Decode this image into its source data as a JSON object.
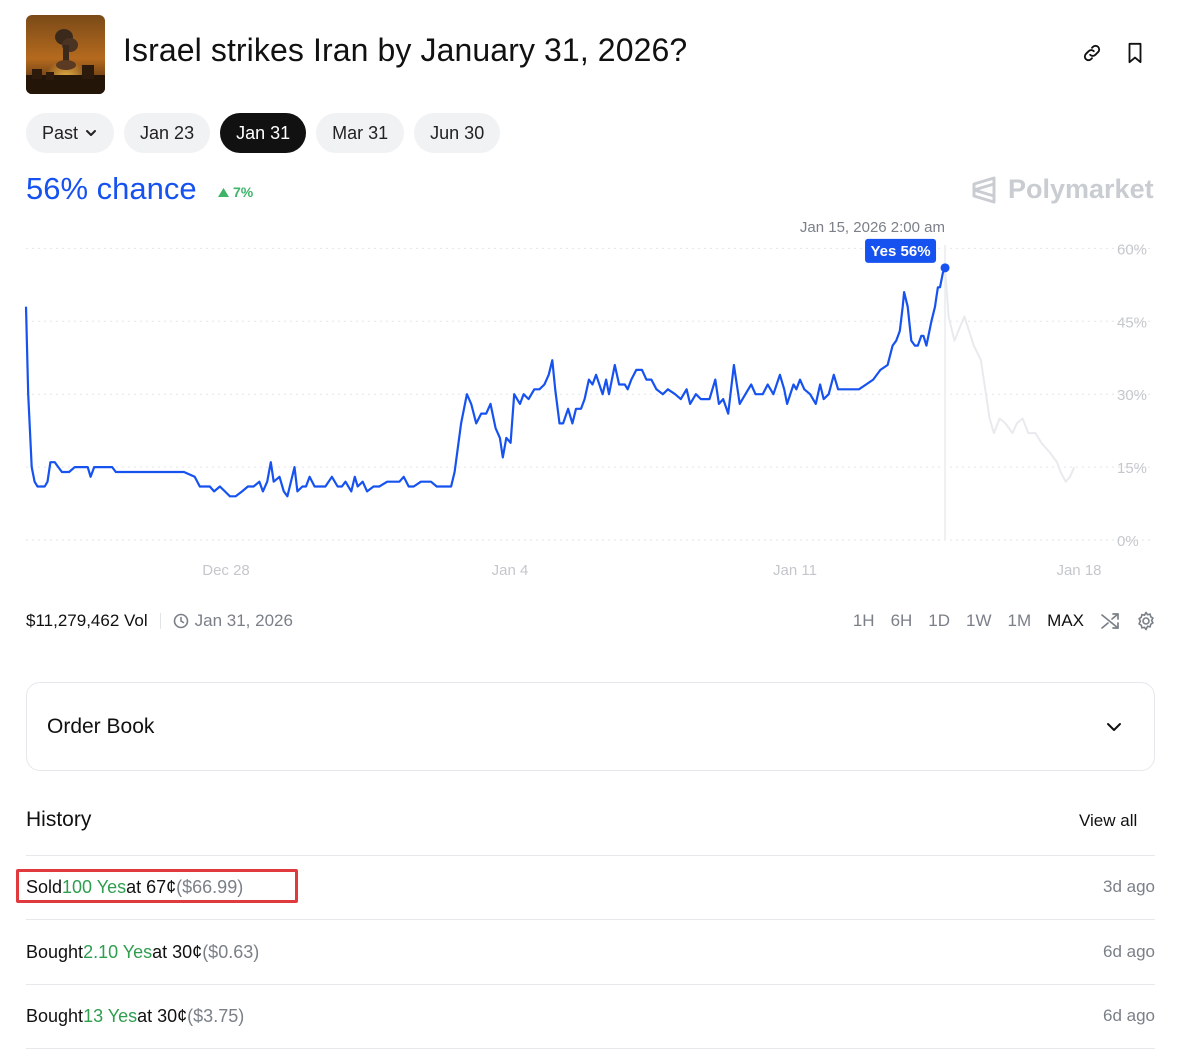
{
  "header": {
    "title": "Israel strikes Iran by January 31, 2026?"
  },
  "date_pills": [
    {
      "label": "Past",
      "active": false,
      "has_chevron": true
    },
    {
      "label": "Jan 23",
      "active": false
    },
    {
      "label": "Jan 31",
      "active": true
    },
    {
      "label": "Mar 31",
      "active": false
    },
    {
      "label": "Jun 30",
      "active": false
    }
  ],
  "summary": {
    "chance": "56% chance",
    "delta": "7%"
  },
  "brand": "Polymarket",
  "chart_data": {
    "type": "line",
    "hover_date": "Jan 15, 2026 2:00 am",
    "tooltip": "Yes 56%",
    "x_tick_labels": [
      "Dec 28",
      "Jan 4",
      "Jan 11",
      "Jan 18"
    ],
    "y_tick_labels": [
      "60%",
      "45%",
      "30%",
      "15%",
      "0%"
    ],
    "ylim": [
      0,
      60
    ],
    "series": [
      {
        "name": "Yes",
        "color": "#1652f0",
        "points": [
          [
            0,
            48
          ],
          [
            0.3,
            30
          ],
          [
            0.8,
            15
          ],
          [
            1.2,
            12
          ],
          [
            1.6,
            11
          ],
          [
            2.2,
            11
          ],
          [
            2.6,
            11
          ],
          [
            3,
            12
          ],
          [
            3.4,
            16
          ],
          [
            4,
            16
          ],
          [
            4.5,
            15
          ],
          [
            5,
            14
          ],
          [
            6,
            14
          ],
          [
            6.8,
            15
          ],
          [
            8,
            15
          ],
          [
            8.6,
            15
          ],
          [
            9,
            13
          ],
          [
            9.5,
            15
          ],
          [
            11,
            15
          ],
          [
            12,
            15
          ],
          [
            12.5,
            14
          ],
          [
            14,
            14
          ],
          [
            14.6,
            14
          ],
          [
            15.2,
            14
          ],
          [
            16,
            14
          ],
          [
            17.2,
            14
          ],
          [
            18,
            14
          ],
          [
            19,
            14
          ],
          [
            20,
            14
          ],
          [
            21,
            14
          ],
          [
            22,
            14
          ],
          [
            23.5,
            13
          ],
          [
            24.2,
            11
          ],
          [
            24.8,
            11
          ],
          [
            25.6,
            11
          ],
          [
            26.2,
            10
          ],
          [
            27,
            11
          ],
          [
            27.7,
            10
          ],
          [
            28.4,
            9
          ],
          [
            29.2,
            9
          ],
          [
            30.1,
            10
          ],
          [
            30.9,
            11
          ],
          [
            31.7,
            11
          ],
          [
            32.5,
            12
          ],
          [
            33,
            10
          ],
          [
            33.6,
            12
          ],
          [
            34.1,
            16
          ],
          [
            34.5,
            12
          ],
          [
            35.3,
            13
          ],
          [
            35.9,
            10
          ],
          [
            36.4,
            9
          ],
          [
            37.4,
            15
          ],
          [
            37.8,
            10
          ],
          [
            38.5,
            11
          ],
          [
            39,
            11
          ],
          [
            39.5,
            13
          ],
          [
            40.2,
            11
          ],
          [
            40.8,
            11
          ],
          [
            41.7,
            11
          ],
          [
            42.6,
            13
          ],
          [
            43.4,
            11
          ],
          [
            44,
            11
          ],
          [
            44.5,
            12
          ],
          [
            45.3,
            10
          ],
          [
            45.8,
            13
          ],
          [
            46.2,
            11
          ],
          [
            46.9,
            12
          ],
          [
            47.5,
            10
          ],
          [
            48.4,
            11
          ],
          [
            49.2,
            11
          ],
          [
            50.3,
            12
          ],
          [
            51.1,
            12
          ],
          [
            52,
            12
          ],
          [
            52.6,
            13
          ],
          [
            53.3,
            11
          ],
          [
            54,
            11
          ],
          [
            55,
            12
          ],
          [
            56.4,
            12
          ],
          [
            57.2,
            11
          ],
          [
            58.2,
            11
          ],
          [
            59.2,
            11
          ],
          [
            59.7,
            14
          ],
          [
            60.6,
            24
          ],
          [
            61.4,
            30
          ],
          [
            62,
            28
          ],
          [
            62.7,
            24
          ],
          [
            63.4,
            26
          ],
          [
            64.1,
            26
          ],
          [
            64.7,
            28
          ],
          [
            65.4,
            23
          ],
          [
            66,
            21
          ],
          [
            66.4,
            17
          ],
          [
            66.9,
            21
          ],
          [
            67.5,
            20
          ],
          [
            68,
            30
          ],
          [
            68.8,
            28
          ],
          [
            69.3,
            30
          ],
          [
            70,
            29
          ],
          [
            70.8,
            31
          ],
          [
            71.5,
            31
          ],
          [
            72.2,
            32
          ],
          [
            72.8,
            34
          ],
          [
            73.3,
            37
          ],
          [
            73.7,
            31
          ],
          [
            74.3,
            24
          ],
          [
            74.8,
            24
          ],
          [
            75.5,
            27
          ],
          [
            76.1,
            24
          ],
          [
            76.6,
            27
          ],
          [
            77.3,
            27
          ],
          [
            77.8,
            29
          ],
          [
            78.4,
            33
          ],
          [
            78.9,
            32
          ],
          [
            79.4,
            34
          ],
          [
            80.3,
            30
          ],
          [
            80.8,
            33
          ],
          [
            81.2,
            30
          ],
          [
            82,
            36
          ],
          [
            82.6,
            32
          ],
          [
            83.4,
            32
          ],
          [
            83.8,
            31
          ],
          [
            84.3,
            33
          ],
          [
            85,
            35
          ],
          [
            85.8,
            35
          ],
          [
            86.4,
            33
          ],
          [
            87.1,
            33
          ],
          [
            87.8,
            31
          ],
          [
            88.7,
            30
          ],
          [
            89.4,
            31
          ],
          [
            90.4,
            30
          ],
          [
            91.2,
            29
          ],
          [
            92,
            31
          ],
          [
            92.5,
            28
          ],
          [
            93.3,
            30
          ],
          [
            94,
            29
          ],
          [
            95.2,
            29
          ],
          [
            96,
            33
          ],
          [
            96.5,
            28
          ],
          [
            97.1,
            29
          ],
          [
            97.8,
            26
          ],
          [
            98.6,
            36
          ],
          [
            99.4,
            28
          ],
          [
            100.2,
            30
          ],
          [
            101,
            32
          ],
          [
            101.6,
            30
          ],
          [
            102.6,
            30
          ],
          [
            103.3,
            32
          ],
          [
            104.1,
            30
          ],
          [
            105,
            34
          ],
          [
            105.6,
            31
          ],
          [
            106,
            28
          ],
          [
            106.9,
            32
          ],
          [
            107.3,
            31
          ],
          [
            107.8,
            33
          ],
          [
            108.4,
            31
          ],
          [
            109.2,
            30
          ],
          [
            110,
            28
          ],
          [
            110.6,
            32
          ],
          [
            111.1,
            29
          ],
          [
            111.8,
            30
          ],
          [
            112.5,
            34
          ],
          [
            113.1,
            31
          ],
          [
            114,
            31
          ],
          [
            115,
            31
          ],
          [
            116,
            31
          ],
          [
            117,
            32
          ],
          [
            118,
            33
          ],
          [
            119,
            35
          ],
          [
            120,
            36
          ],
          [
            120.7,
            40
          ],
          [
            121.2,
            41
          ],
          [
            121.7,
            43
          ],
          [
            122.1,
            48
          ],
          [
            122.3,
            51
          ],
          [
            122.8,
            48
          ],
          [
            123.3,
            41
          ],
          [
            123.8,
            40
          ],
          [
            124.2,
            40
          ],
          [
            124.7,
            42
          ],
          [
            125,
            42
          ],
          [
            125.4,
            40
          ],
          [
            126.1,
            45
          ],
          [
            126.6,
            48
          ],
          [
            126.8,
            50
          ],
          [
            127,
            52
          ],
          [
            127.3,
            52
          ],
          [
            127.7,
            55
          ],
          [
            128,
            56
          ]
        ]
      },
      {
        "name": "Yes (faded)",
        "color": "#e8eaed",
        "points": [
          [
            128,
            56
          ],
          [
            128.5,
            46
          ],
          [
            129.3,
            41
          ],
          [
            130.7,
            46
          ],
          [
            132,
            40
          ],
          [
            133,
            37
          ],
          [
            134.2,
            25
          ],
          [
            134.8,
            22
          ],
          [
            135.6,
            25
          ],
          [
            136.4,
            24
          ],
          [
            137.4,
            22
          ],
          [
            138,
            24
          ],
          [
            138.8,
            25
          ],
          [
            139.6,
            22
          ],
          [
            140.6,
            22
          ],
          [
            141.4,
            20
          ],
          [
            142.6,
            18
          ],
          [
            143.6,
            16
          ],
          [
            144.1,
            14
          ],
          [
            144.8,
            12
          ],
          [
            145.4,
            13
          ],
          [
            146,
            15
          ]
        ]
      }
    ]
  },
  "stats": {
    "volume": "$11,279,462 Vol",
    "end_date": "Jan 31, 2026"
  },
  "ranges": [
    {
      "label": "1H",
      "active": false
    },
    {
      "label": "6H",
      "active": false
    },
    {
      "label": "1D",
      "active": false
    },
    {
      "label": "1W",
      "active": false
    },
    {
      "label": "1M",
      "active": false
    },
    {
      "label": "MAX",
      "active": true
    }
  ],
  "order_book": {
    "title": "Order Book"
  },
  "history": {
    "title": "History",
    "view_all": "View all",
    "rows": [
      {
        "action": "Sold",
        "amount": "100 Yes",
        "price": "at 67¢",
        "usd": "($66.99)",
        "ago": "3d ago"
      },
      {
        "action": "Bought",
        "amount": "2.10 Yes",
        "price": "at 30¢",
        "usd": "($0.63)",
        "ago": "6d ago"
      },
      {
        "action": "Bought",
        "amount": "13 Yes",
        "price": "at 30¢",
        "usd": "($3.75)",
        "ago": "6d ago"
      }
    ]
  }
}
